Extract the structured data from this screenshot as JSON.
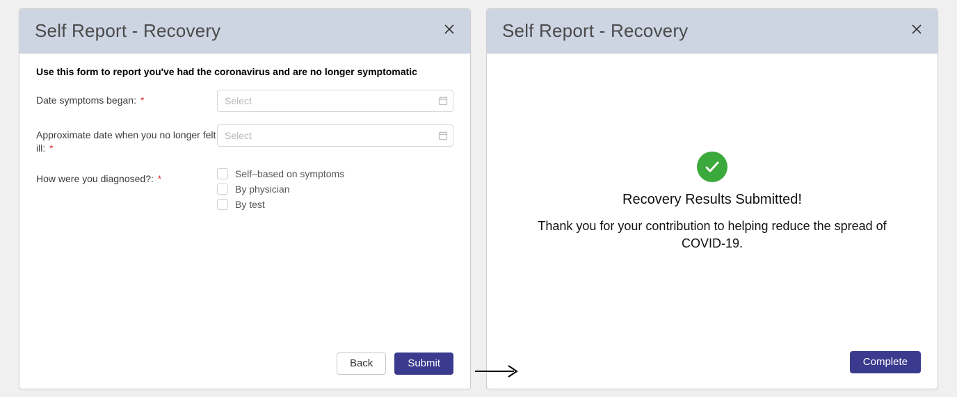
{
  "left": {
    "title": "Self Report - Recovery",
    "instructions": "Use this form to report you've had the coronavirus and are no longer symptomatic",
    "fields": {
      "symptoms_began": {
        "label": "Date symptoms began:",
        "placeholder": "Select"
      },
      "no_longer_ill": {
        "label": "Approximate  date when you no longer felt ill:",
        "placeholder": "Select"
      },
      "diagnosed": {
        "label": "How were you diagnosed?:",
        "options": {
          "self": "Self–based on symptoms",
          "physician": "By physician",
          "test": "By test"
        }
      }
    },
    "buttons": {
      "back": "Back",
      "submit": "Submit"
    },
    "required_marker": "*"
  },
  "right": {
    "title": "Self Report - Recovery",
    "success_title": "Recovery Results Submitted!",
    "success_text": "Thank you for your contribution to helping reduce the spread of COVID-19.",
    "buttons": {
      "complete": "Complete"
    }
  }
}
